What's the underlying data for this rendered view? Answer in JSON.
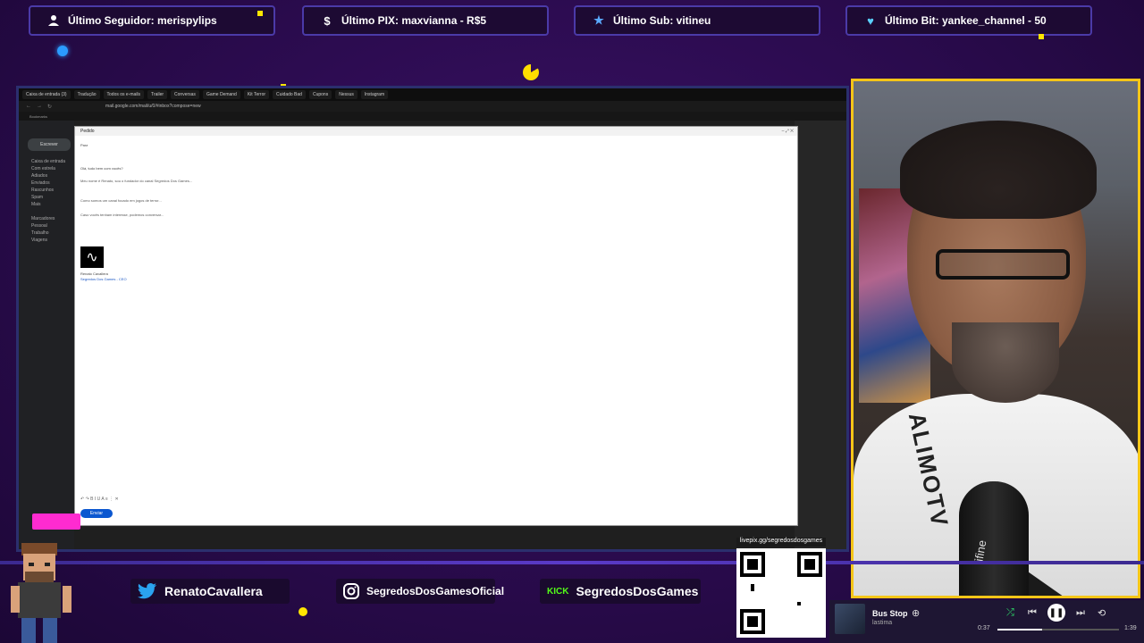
{
  "top_bar": {
    "follower": "Último Seguidor: merispylips",
    "pix": "Último PIX: maxvianna - R$5",
    "sub": "Último Sub: vitineu",
    "bit": "Último Bit: yankee_channel - 50"
  },
  "browser": {
    "tabs": [
      "Caixa de entrada (3)",
      "Tradução",
      "Todos os e-mails",
      "Trailer",
      "Conversas",
      "Game Demand",
      "Kit Terror",
      "Cuidado Bad",
      "Cupons",
      "Nessus",
      "Instagram"
    ],
    "url": "mail.google.com/mail/u/0/#inbox?compose=new",
    "bookmarks": "Bookmarks"
  },
  "gmail": {
    "compose": "Escrever",
    "folders": [
      "Caixa de entrada",
      "Com estrela",
      "Adiados",
      "Enviados",
      "Rascunhos",
      "Spam",
      "Mais"
    ],
    "labels_header": "Marcadores",
    "labels": [
      "Pessoal",
      "Trabalho",
      "Viagens"
    ]
  },
  "mail": {
    "window_title": "Pedido",
    "lines": [
      "Para",
      "Olá, tudo bem com vocês?"
    ],
    "paragraphs": [
      "Meu nome é Renato, sou o fundador do canal Segredos Dos Games...",
      "Como somos um canal focado em jogos de terror...",
      "Caso vocês tenham interesse, podemos conversar..."
    ],
    "signature": [
      "Renato Cavallera",
      "Segredos Dos Games - CEO"
    ],
    "send": "Enviar"
  },
  "social": {
    "twitter": "RenatoCavallera",
    "instagram": "SegredosDosGamesOficial",
    "kick": "SegredosDosGames",
    "kick_badge": "KICK"
  },
  "qr_label": "livepix.gg/segredosdosgames",
  "player": {
    "track": "Bus Stop",
    "artist": "lastima",
    "elapsed": "0:37",
    "total": "1:39",
    "progress": 0.37
  },
  "cam": {
    "shirt_text": "ALIMOTV",
    "mic_brand": "fifine"
  }
}
